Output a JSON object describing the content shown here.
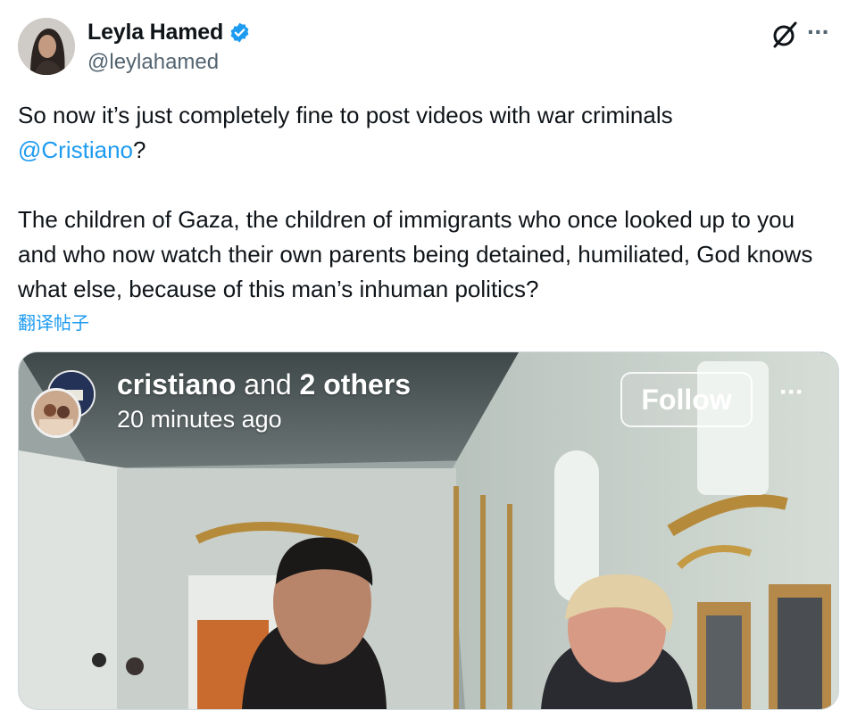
{
  "author": {
    "display_name": "Leyla Hamed",
    "handle": "@leylahamed",
    "verified": true,
    "verified_color": "#1d9bf0"
  },
  "header_icons": {
    "grok_icon": "grok-icon",
    "more_icon": "more-options-icon",
    "more_label": "···"
  },
  "tweet": {
    "line1": "So now it’s just completely fine to post videos with war criminals",
    "mention": "@Cristiano",
    "mention_suffix": "?",
    "paragraph2": "The children of Gaza, the children of immigrants who once looked up to you and who now watch their own parents being detained, humiliated, God knows what else, because of this man’s inhuman politics?",
    "translate_label": "翻译帖子"
  },
  "media": {
    "ig_user_name": "cristiano",
    "ig_and": " and ",
    "ig_others": "2 others",
    "ig_time": "20 minutes ago",
    "follow_label": "Follow",
    "more_label": "···"
  },
  "colors": {
    "accent": "#1d9bf0",
    "text": "#0f1419",
    "secondary": "#536471"
  }
}
